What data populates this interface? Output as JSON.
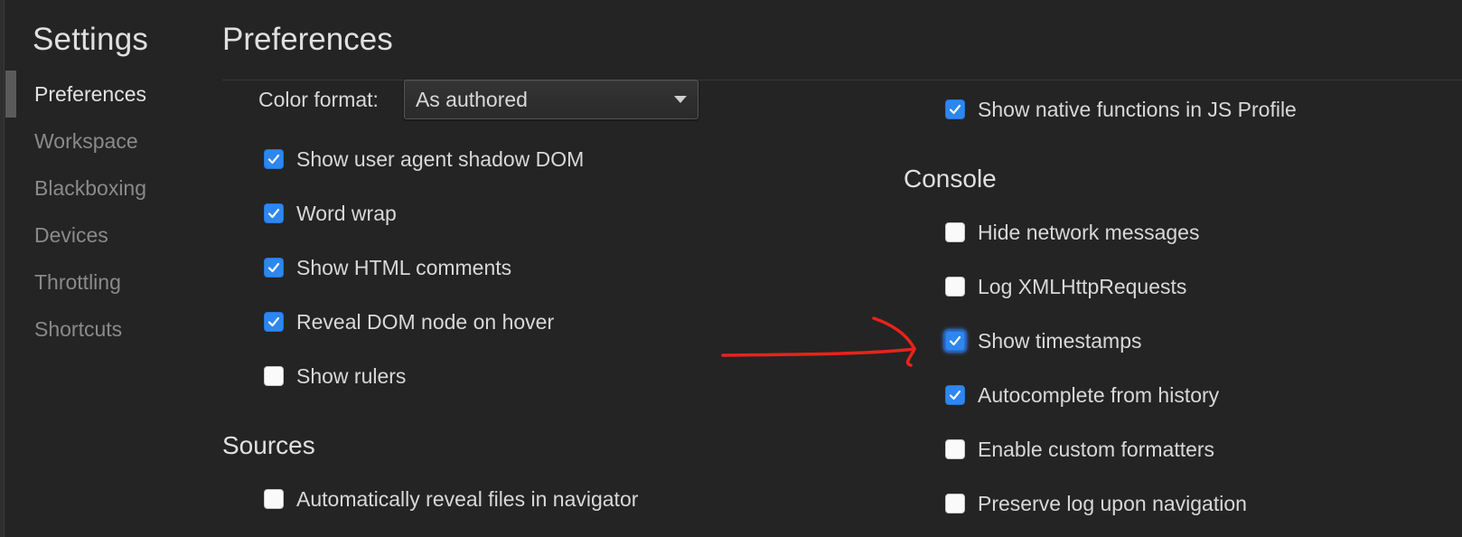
{
  "sidebar": {
    "title": "Settings",
    "items": [
      {
        "label": "Preferences"
      },
      {
        "label": "Workspace"
      },
      {
        "label": "Blackboxing"
      },
      {
        "label": "Devices"
      },
      {
        "label": "Throttling"
      },
      {
        "label": "Shortcuts"
      }
    ],
    "selected": "Preferences"
  },
  "main": {
    "title": "Preferences",
    "color_format": {
      "label": "Color format:",
      "value": "As authored"
    },
    "elements_options": [
      {
        "label": "Show user agent shadow DOM",
        "checked": true
      },
      {
        "label": "Word wrap",
        "checked": true
      },
      {
        "label": "Show HTML comments",
        "checked": true
      },
      {
        "label": "Reveal DOM node on hover",
        "checked": true
      },
      {
        "label": "Show rulers",
        "checked": false
      }
    ],
    "sources": {
      "title": "Sources",
      "options": [
        {
          "label": "Automatically reveal files in navigator",
          "checked": false
        }
      ]
    },
    "profiler_options": [
      {
        "label": "Show native functions in JS Profile",
        "checked": true
      }
    ],
    "console": {
      "title": "Console",
      "options": [
        {
          "label": "Hide network messages",
          "checked": false
        },
        {
          "label": "Log XMLHttpRequests",
          "checked": false
        },
        {
          "label": "Show timestamps",
          "checked": true,
          "focused": true
        },
        {
          "label": "Autocomplete from history",
          "checked": true
        },
        {
          "label": "Enable custom formatters",
          "checked": false
        },
        {
          "label": "Preserve log upon navigation",
          "checked": false
        }
      ]
    }
  },
  "colors": {
    "background": "#242424",
    "checkbox_checked": "#2e86f0",
    "annotation_arrow": "#e8231a"
  },
  "icons": {
    "checkmark": "checkmark-icon",
    "dropdown": "chevron-down-icon"
  }
}
